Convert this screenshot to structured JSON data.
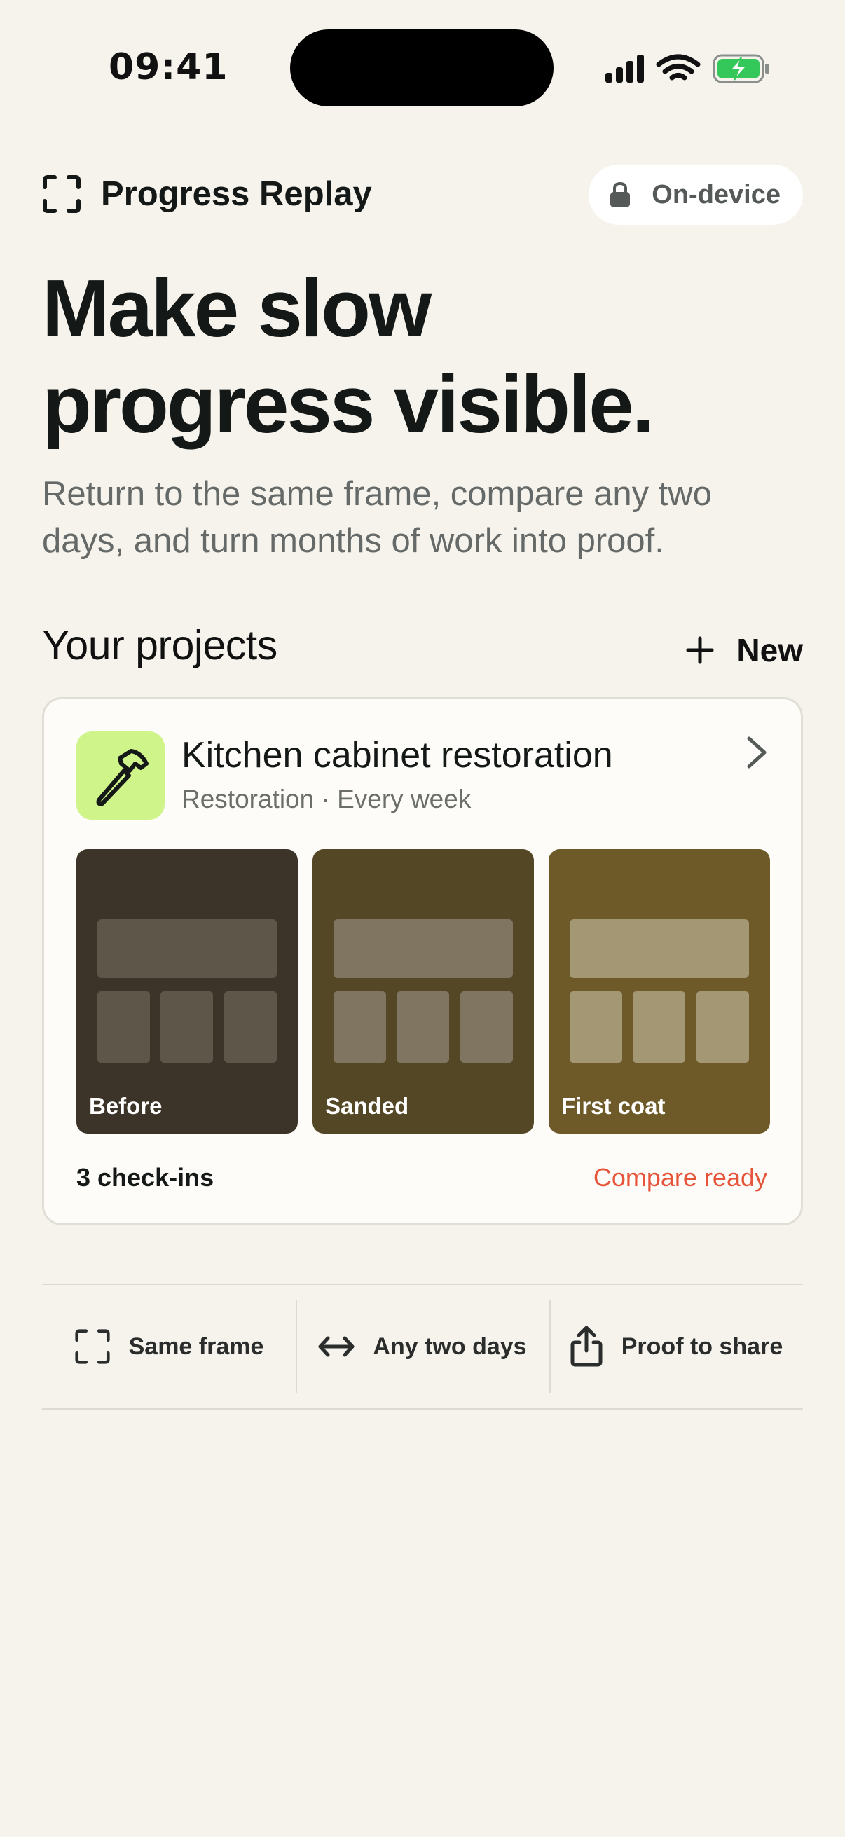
{
  "status_bar": {
    "time": "09:41"
  },
  "header": {
    "app_name": "Progress Replay",
    "privacy_badge": "On-device"
  },
  "hero": {
    "title_line1": "Make slow",
    "title_line2": "progress visible.",
    "subtitle": "Return to the same frame, compare any two days, and turn months of work into proof."
  },
  "projects": {
    "title": "Your projects",
    "new_label": "New",
    "items": [
      {
        "name": "Kitchen cabinet restoration",
        "meta": "Restoration · Every week",
        "icon": "hammer-icon",
        "thumbnails": [
          "Before",
          "Sanded",
          "First coat"
        ],
        "checkins": "3 check-ins",
        "status": "Compare ready"
      }
    ]
  },
  "features": [
    {
      "icon": "frame-icon",
      "label": "Same frame"
    },
    {
      "icon": "arrows-horizontal-icon",
      "label": "Any two days"
    },
    {
      "icon": "share-icon",
      "label": "Proof to share"
    }
  ],
  "colors": {
    "background": "#F5F3EC",
    "accent_green": "#CFF48A",
    "status_red": "#E6553A",
    "battery_green": "#34C759"
  }
}
